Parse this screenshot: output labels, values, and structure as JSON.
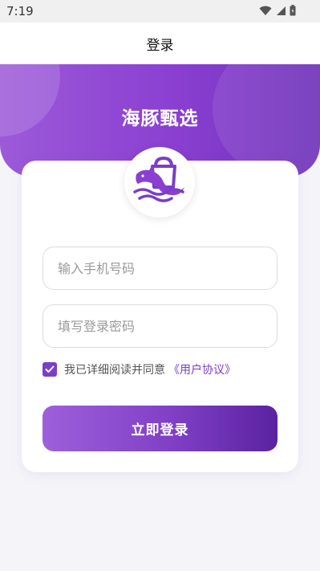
{
  "status_bar": {
    "time": "7:19",
    "icons": [
      "wifi-icon",
      "signal-icon",
      "battery-icon"
    ]
  },
  "nav": {
    "title": "登录"
  },
  "brand": {
    "title": "海豚甄选",
    "logo_icon": "dolphin-shopping-bag-logo"
  },
  "form": {
    "phone_placeholder": "输入手机号码",
    "phone_value": "",
    "password_placeholder": "填写登录密码",
    "password_value": "",
    "agree_checked": true,
    "agree_text": "我已详细阅读并同意",
    "agreement_link": "《用户协议》",
    "login_label": "立即登录"
  },
  "colors": {
    "primary": "#7a3ec7",
    "header_gradient_start": "#9c5ad8",
    "header_gradient_end": "#6e31b8",
    "background": "#f5f5f9"
  }
}
